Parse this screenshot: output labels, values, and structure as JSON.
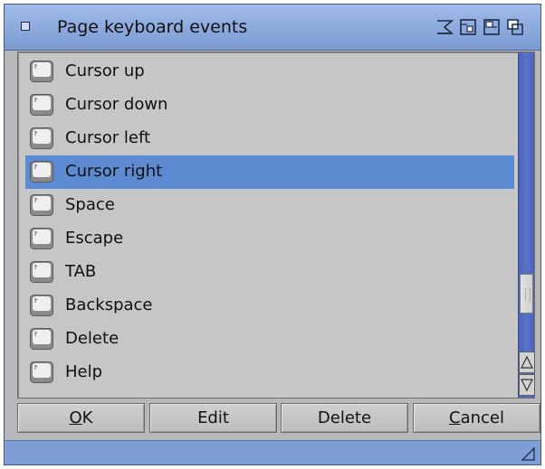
{
  "window": {
    "title": "Page keyboard events",
    "title_bar_color": "#7b9bd2",
    "selection_color": "#5d8bd2",
    "gadgets": [
      "close-gadget",
      "iconify-icon",
      "zoom-icon",
      "toggle-size-icon",
      "depth-icon"
    ]
  },
  "list": {
    "items": [
      {
        "label": "Cursor up",
        "icon": "keyboard-key-icon",
        "selected": false
      },
      {
        "label": "Cursor down",
        "icon": "keyboard-key-icon",
        "selected": false
      },
      {
        "label": "Cursor left",
        "icon": "keyboard-key-icon",
        "selected": false
      },
      {
        "label": "Cursor right",
        "icon": "keyboard-key-icon",
        "selected": true
      },
      {
        "label": "Space",
        "icon": "keyboard-key-icon",
        "selected": false
      },
      {
        "label": "Escape",
        "icon": "keyboard-key-icon",
        "selected": false
      },
      {
        "label": "TAB",
        "icon": "keyboard-key-icon",
        "selected": false
      },
      {
        "label": "Backspace",
        "icon": "keyboard-key-icon",
        "selected": false
      },
      {
        "label": "Delete",
        "icon": "keyboard-key-icon",
        "selected": false
      },
      {
        "label": "Help",
        "icon": "keyboard-key-icon",
        "selected": false
      }
    ],
    "scroll_up_glyph": "△",
    "scroll_down_glyph": "▽"
  },
  "buttons": {
    "ok": {
      "underlined": "O",
      "rest": "K"
    },
    "edit": "Edit",
    "delete": "Delete",
    "cancel": {
      "underlined": "C",
      "rest": "ancel"
    }
  }
}
